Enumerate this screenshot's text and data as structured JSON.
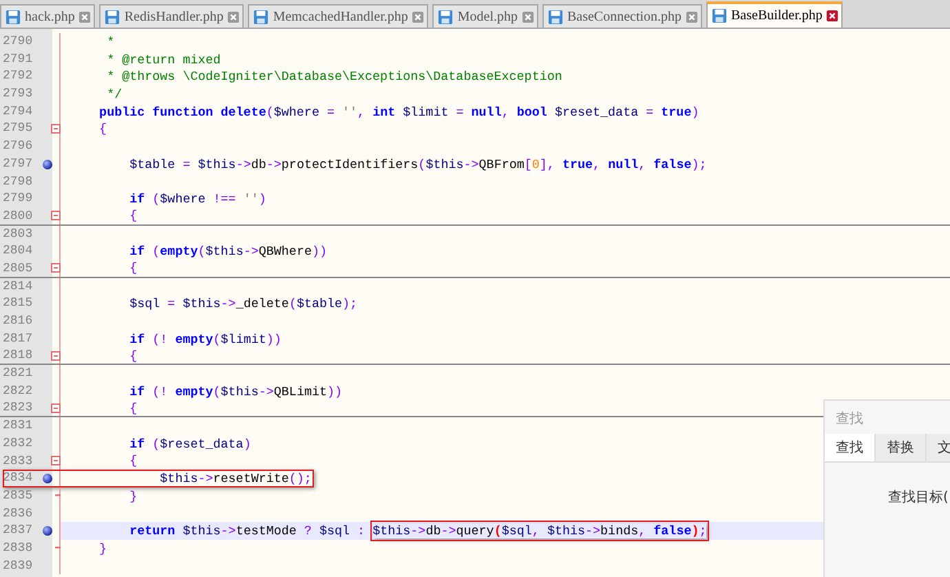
{
  "tabs": [
    {
      "label": "hack.php",
      "selected": false
    },
    {
      "label": "RedisHandler.php",
      "selected": false
    },
    {
      "label": "MemcachedHandler.php",
      "selected": false
    },
    {
      "label": "Model.php",
      "selected": false
    },
    {
      "label": "BaseConnection.php",
      "selected": false
    },
    {
      "label": "BaseBuilder.php",
      "selected": true
    }
  ],
  "lines": [
    {
      "number": "2790",
      "fold_start": false,
      "fold_end": false,
      "folded": false,
      "bookmark": false,
      "current": false,
      "annotated": false,
      "tokens": [
        {
          "kind": "comment",
          "text": "     *"
        }
      ]
    },
    {
      "number": "2791",
      "fold_start": false,
      "fold_end": false,
      "folded": false,
      "bookmark": false,
      "current": false,
      "annotated": false,
      "tokens": [
        {
          "kind": "comment",
          "text": "     * @return mixed"
        }
      ]
    },
    {
      "number": "2792",
      "fold_start": false,
      "fold_end": false,
      "folded": false,
      "bookmark": false,
      "current": false,
      "annotated": false,
      "tokens": [
        {
          "kind": "comment",
          "text": "     * @throws \\CodeIgniter\\Database\\Exceptions\\DatabaseException"
        }
      ]
    },
    {
      "number": "2793",
      "fold_start": false,
      "fold_end": false,
      "folded": false,
      "bookmark": false,
      "current": false,
      "annotated": false,
      "tokens": [
        {
          "kind": "comment",
          "text": "     */"
        }
      ]
    },
    {
      "number": "2794",
      "fold_start": false,
      "fold_end": false,
      "folded": false,
      "bookmark": false,
      "current": false,
      "annotated": false,
      "tokens": [
        {
          "kind": "keyword",
          "text": "    public function delete"
        },
        {
          "kind": "operator",
          "text": "("
        },
        {
          "kind": "variable",
          "text": "$where"
        },
        {
          "kind": "operator",
          "text": " = "
        },
        {
          "kind": "string",
          "text": "''"
        },
        {
          "kind": "operator",
          "text": ", "
        },
        {
          "kind": "keyword",
          "text": "int "
        },
        {
          "kind": "variable",
          "text": "$limit"
        },
        {
          "kind": "operator",
          "text": " = "
        },
        {
          "kind": "keyword",
          "text": "null"
        },
        {
          "kind": "operator",
          "text": ", "
        },
        {
          "kind": "keyword",
          "text": "bool "
        },
        {
          "kind": "variable",
          "text": "$reset_data"
        },
        {
          "kind": "operator",
          "text": " = "
        },
        {
          "kind": "keyword",
          "text": "true"
        },
        {
          "kind": "operator",
          "text": ")"
        }
      ]
    },
    {
      "number": "2795",
      "fold_start": true,
      "fold_end": false,
      "folded": false,
      "bookmark": false,
      "current": false,
      "annotated": false,
      "tokens": [
        {
          "kind": "operator",
          "text": "    {"
        }
      ]
    },
    {
      "number": "2796",
      "fold_start": false,
      "fold_end": false,
      "folded": false,
      "bookmark": false,
      "current": false,
      "annotated": false
    },
    {
      "number": "2797",
      "fold_start": false,
      "fold_end": false,
      "folded": false,
      "bookmark": true,
      "current": false,
      "annotated": false,
      "tokens": [
        {
          "kind": "variable",
          "text": "        $table"
        },
        {
          "kind": "operator",
          "text": " = "
        },
        {
          "kind": "variable",
          "text": "$this"
        },
        {
          "kind": "operator",
          "text": "->"
        },
        {
          "kind": "plain",
          "text": "db"
        },
        {
          "kind": "operator",
          "text": "->"
        },
        {
          "kind": "plain",
          "text": "protectIdentifiers"
        },
        {
          "kind": "operator",
          "text": "("
        },
        {
          "kind": "variable",
          "text": "$this"
        },
        {
          "kind": "operator",
          "text": "->"
        },
        {
          "kind": "plain",
          "text": "QBFrom"
        },
        {
          "kind": "operator",
          "text": "["
        },
        {
          "kind": "number",
          "text": "0"
        },
        {
          "kind": "operator",
          "text": "], "
        },
        {
          "kind": "keyword",
          "text": "true"
        },
        {
          "kind": "operator",
          "text": ", "
        },
        {
          "kind": "keyword",
          "text": "null"
        },
        {
          "kind": "operator",
          "text": ", "
        },
        {
          "kind": "keyword",
          "text": "false"
        },
        {
          "kind": "operator",
          "text": ");"
        }
      ]
    },
    {
      "number": "2798",
      "fold_start": false,
      "fold_end": false,
      "folded": false,
      "bookmark": false,
      "current": false,
      "annotated": false
    },
    {
      "number": "2799",
      "fold_start": false,
      "fold_end": false,
      "folded": false,
      "bookmark": false,
      "current": false,
      "annotated": false,
      "tokens": [
        {
          "kind": "keyword",
          "text": "        if"
        },
        {
          "kind": "operator",
          "text": " ("
        },
        {
          "kind": "variable",
          "text": "$where"
        },
        {
          "kind": "operator",
          "text": " !== "
        },
        {
          "kind": "string",
          "text": "''"
        },
        {
          "kind": "operator",
          "text": ")"
        }
      ]
    },
    {
      "number": "2800",
      "fold_start": true,
      "fold_end": false,
      "folded": true,
      "bookmark": false,
      "current": false,
      "annotated": false,
      "tokens": [
        {
          "kind": "operator",
          "text": "        {"
        }
      ]
    },
    {
      "number": "2803",
      "fold_start": false,
      "fold_end": false,
      "folded": false,
      "bookmark": false,
      "current": false,
      "annotated": false
    },
    {
      "number": "2804",
      "fold_start": false,
      "fold_end": false,
      "folded": false,
      "bookmark": false,
      "current": false,
      "annotated": false,
      "tokens": [
        {
          "kind": "keyword",
          "text": "        if"
        },
        {
          "kind": "operator",
          "text": " ("
        },
        {
          "kind": "keyword",
          "text": "empty"
        },
        {
          "kind": "operator",
          "text": "("
        },
        {
          "kind": "variable",
          "text": "$this"
        },
        {
          "kind": "operator",
          "text": "->"
        },
        {
          "kind": "plain",
          "text": "QBWhere"
        },
        {
          "kind": "operator",
          "text": "))"
        }
      ]
    },
    {
      "number": "2805",
      "fold_start": true,
      "fold_end": false,
      "folded": true,
      "bookmark": false,
      "current": false,
      "annotated": false,
      "tokens": [
        {
          "kind": "operator",
          "text": "        {"
        }
      ]
    },
    {
      "number": "2814",
      "fold_start": false,
      "fold_end": false,
      "folded": false,
      "bookmark": false,
      "current": false,
      "annotated": false
    },
    {
      "number": "2815",
      "fold_start": false,
      "fold_end": false,
      "folded": false,
      "bookmark": false,
      "current": false,
      "annotated": false,
      "tokens": [
        {
          "kind": "variable",
          "text": "        $sql"
        },
        {
          "kind": "operator",
          "text": " = "
        },
        {
          "kind": "variable",
          "text": "$this"
        },
        {
          "kind": "operator",
          "text": "->"
        },
        {
          "kind": "plain",
          "text": "_delete"
        },
        {
          "kind": "operator",
          "text": "("
        },
        {
          "kind": "variable",
          "text": "$table"
        },
        {
          "kind": "operator",
          "text": ");"
        }
      ]
    },
    {
      "number": "2816",
      "fold_start": false,
      "fold_end": false,
      "folded": false,
      "bookmark": false,
      "current": false,
      "annotated": false
    },
    {
      "number": "2817",
      "fold_start": false,
      "fold_end": false,
      "folded": false,
      "bookmark": false,
      "current": false,
      "annotated": false,
      "tokens": [
        {
          "kind": "keyword",
          "text": "        if"
        },
        {
          "kind": "operator",
          "text": " (! "
        },
        {
          "kind": "keyword",
          "text": "empty"
        },
        {
          "kind": "operator",
          "text": "("
        },
        {
          "kind": "variable",
          "text": "$limit"
        },
        {
          "kind": "operator",
          "text": "))"
        }
      ]
    },
    {
      "number": "2818",
      "fold_start": true,
      "fold_end": false,
      "folded": true,
      "bookmark": false,
      "current": false,
      "annotated": false,
      "tokens": [
        {
          "kind": "operator",
          "text": "        {"
        }
      ]
    },
    {
      "number": "2821",
      "fold_start": false,
      "fold_end": false,
      "folded": false,
      "bookmark": false,
      "current": false,
      "annotated": false
    },
    {
      "number": "2822",
      "fold_start": false,
      "fold_end": false,
      "folded": false,
      "bookmark": false,
      "current": false,
      "annotated": false,
      "tokens": [
        {
          "kind": "keyword",
          "text": "        if"
        },
        {
          "kind": "operator",
          "text": " (! "
        },
        {
          "kind": "keyword",
          "text": "empty"
        },
        {
          "kind": "operator",
          "text": "("
        },
        {
          "kind": "variable",
          "text": "$this"
        },
        {
          "kind": "operator",
          "text": "->"
        },
        {
          "kind": "plain",
          "text": "QBLimit"
        },
        {
          "kind": "operator",
          "text": "))"
        }
      ]
    },
    {
      "number": "2823",
      "fold_start": true,
      "fold_end": false,
      "folded": true,
      "bookmark": false,
      "current": false,
      "annotated": false,
      "tokens": [
        {
          "kind": "operator",
          "text": "        {"
        }
      ]
    },
    {
      "number": "2831",
      "fold_start": false,
      "fold_end": false,
      "folded": false,
      "bookmark": false,
      "current": false,
      "annotated": false
    },
    {
      "number": "2832",
      "fold_start": false,
      "fold_end": false,
      "folded": false,
      "bookmark": false,
      "current": false,
      "annotated": false,
      "tokens": [
        {
          "kind": "keyword",
          "text": "        if"
        },
        {
          "kind": "operator",
          "text": " ("
        },
        {
          "kind": "variable",
          "text": "$reset_data"
        },
        {
          "kind": "operator",
          "text": ")"
        }
      ]
    },
    {
      "number": "2833",
      "fold_start": true,
      "fold_end": false,
      "folded": false,
      "bookmark": false,
      "current": false,
      "annotated": false,
      "tokens": [
        {
          "kind": "operator",
          "text": "        {"
        }
      ]
    },
    {
      "number": "2834",
      "fold_start": false,
      "fold_end": false,
      "folded": false,
      "bookmark": true,
      "current": false,
      "annotated": true,
      "tokens": [
        {
          "kind": "variable",
          "text": "            $this"
        },
        {
          "kind": "operator",
          "text": "->"
        },
        {
          "kind": "plain",
          "text": "resetWrite"
        },
        {
          "kind": "operator",
          "text": "();"
        }
      ]
    },
    {
      "number": "2835",
      "fold_start": false,
      "fold_end": true,
      "folded": false,
      "bookmark": false,
      "current": false,
      "annotated": false,
      "tokens": [
        {
          "kind": "operator",
          "text": "        }"
        }
      ]
    },
    {
      "number": "2836",
      "fold_start": false,
      "fold_end": false,
      "folded": false,
      "bookmark": false,
      "current": false,
      "annotated": false
    },
    {
      "number": "2837",
      "fold_start": false,
      "fold_end": false,
      "folded": false,
      "bookmark": true,
      "current": true,
      "annotated": false,
      "tokens": [
        {
          "kind": "keyword",
          "text": "        return "
        },
        {
          "kind": "variable",
          "text": "$this"
        },
        {
          "kind": "operator",
          "text": "->"
        },
        {
          "kind": "plain",
          "text": "testMode"
        },
        {
          "kind": "operator",
          "text": " ? "
        },
        {
          "kind": "variable",
          "text": "$sql"
        },
        {
          "kind": "operator",
          "text": " : "
        }
      ],
      "boxed_tokens": [
        {
          "kind": "variable",
          "text": "$this"
        },
        {
          "kind": "operator",
          "text": "->"
        },
        {
          "kind": "plain",
          "text": "db"
        },
        {
          "kind": "operator",
          "text": "->"
        },
        {
          "kind": "plain",
          "text": "query"
        },
        {
          "kind": "match",
          "text": "("
        },
        {
          "kind": "variable",
          "text": "$sql"
        },
        {
          "kind": "operator",
          "text": ", "
        },
        {
          "kind": "variable",
          "text": "$this"
        },
        {
          "kind": "operator",
          "text": "->"
        },
        {
          "kind": "plain",
          "text": "binds"
        },
        {
          "kind": "operator",
          "text": ", "
        },
        {
          "kind": "keyword",
          "text": "false"
        },
        {
          "kind": "match",
          "text": ")"
        },
        {
          "kind": "operator",
          "text": ";"
        }
      ]
    },
    {
      "number": "2838",
      "fold_start": false,
      "fold_end": true,
      "folded": false,
      "bookmark": false,
      "current": false,
      "annotated": false,
      "tokens": [
        {
          "kind": "operator",
          "text": "    }"
        }
      ]
    },
    {
      "number": "2839",
      "fold_start": false,
      "fold_end": false,
      "folded": false,
      "bookmark": false,
      "current": false,
      "annotated": false
    }
  ],
  "find_panel": {
    "title": "查找",
    "tabs": [
      {
        "label": "查找",
        "selected": true
      },
      {
        "label": "替换",
        "selected": false
      },
      {
        "label": "文",
        "selected": false
      }
    ],
    "field_label": "查找目标("
  }
}
